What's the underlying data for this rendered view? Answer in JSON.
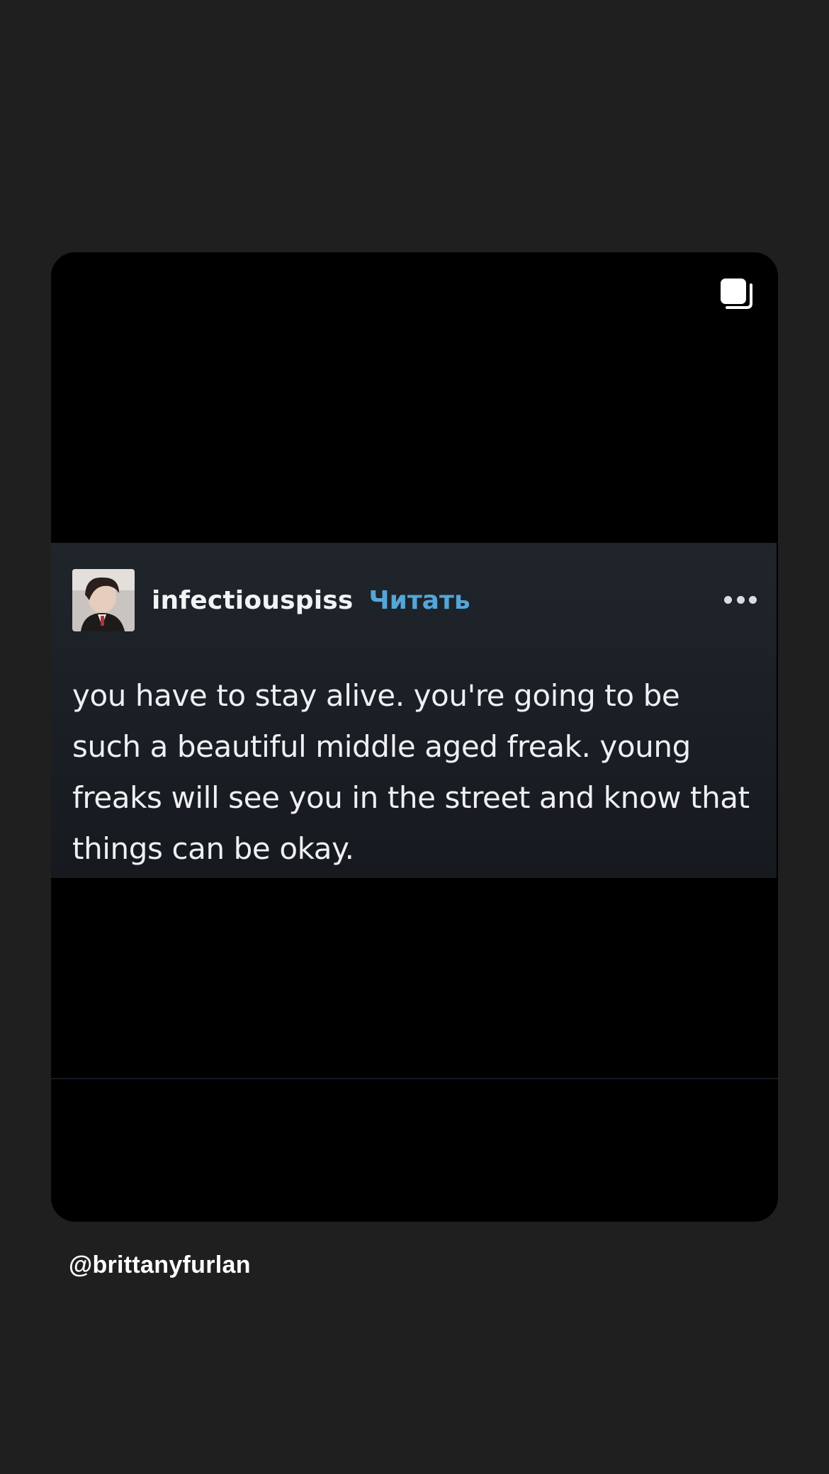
{
  "card": {
    "corner_icon": "multiple-images-icon"
  },
  "post": {
    "avatar_icon": "profile-avatar-icon",
    "username": "infectiouspiss",
    "follow_label": "Читать",
    "more_icon": "more-options-icon",
    "text": "you have to stay alive. you're going to be such a beautiful middle aged freak. young freaks will see you in the street and know that things can be okay."
  },
  "mention": "@brittanyfurlan",
  "colors": {
    "background": "#1f1f1f",
    "card": "#000000",
    "post_background": "#1c2127",
    "follow_link": "#54a6d8",
    "text": "#eef0f2"
  }
}
